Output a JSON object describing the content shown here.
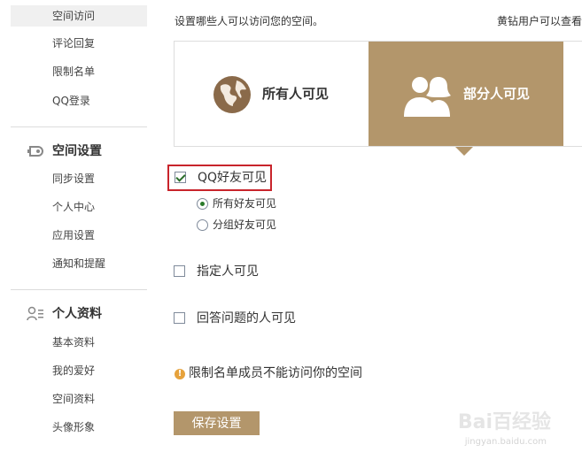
{
  "sidebar": {
    "group1_items": [
      {
        "label": "空间访问",
        "active": true
      },
      {
        "label": "评论回复"
      },
      {
        "label": "限制名单"
      },
      {
        "label": "QQ登录"
      }
    ],
    "group2": {
      "title": "空间设置",
      "icon": "settings-icon",
      "items": [
        {
          "label": "同步设置"
        },
        {
          "label": "个人中心"
        },
        {
          "label": "应用设置"
        },
        {
          "label": "通知和提醒"
        }
      ]
    },
    "group3": {
      "title": "个人资料",
      "icon": "profile-icon",
      "items": [
        {
          "label": "基本资料"
        },
        {
          "label": "我的爱好"
        },
        {
          "label": "空间资料"
        },
        {
          "label": "头像形象"
        }
      ]
    }
  },
  "main": {
    "intro": "设置哪些人可以访问您的空间。",
    "vip_note": "黄钻用户可以查看",
    "visibility": {
      "all_label": "所有人可见",
      "some_label": "部分人可见",
      "selected": "some"
    },
    "options": {
      "qq_friends": {
        "label": "QQ好友可见",
        "checked": true
      },
      "all_friends": {
        "label": "所有好友可见",
        "selected": true
      },
      "group_friends": {
        "label": "分组好友可见",
        "selected": false
      },
      "specific": {
        "label": "指定人可见",
        "checked": false
      },
      "answer": {
        "label": "回答问题的人可见",
        "checked": false
      }
    },
    "notice": "限制名单成员不能访问你的空间",
    "save_label": "保存设置"
  },
  "watermark": {
    "brand": "Bai百经验",
    "url": "jingyan.baidu.com"
  },
  "colors": {
    "accent": "#b3966b",
    "highlight_border": "#c8242b",
    "warning": "#e6a23c"
  }
}
